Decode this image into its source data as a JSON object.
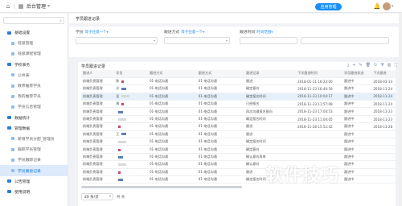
{
  "header": {
    "app_title": "后台管理",
    "app_button": "应用管理"
  },
  "sidebar": {
    "search_placeholder": "",
    "items": [
      {
        "label": "基础设置",
        "level": 1
      },
      {
        "label": "班级管理",
        "level": 2
      },
      {
        "label": "班级课程管理",
        "level": 2
      },
      {
        "label": "学校事务",
        "level": 1
      },
      {
        "label": "公共表",
        "level": 2
      },
      {
        "label": "教师推荐学员",
        "level": 2
      },
      {
        "label": "我的推荐学员",
        "level": 2
      },
      {
        "label": "学员信息管理",
        "level": 2
      },
      {
        "label": "数据统计",
        "level": 1
      },
      {
        "label": "管理数据",
        "level": 1
      },
      {
        "label": "新增学员分配_管理员",
        "level": 2
      },
      {
        "label": "跟踪学员管理",
        "level": 2
      },
      {
        "label": "学员跟踪记录",
        "level": 2
      },
      {
        "label": "学员跟进记录",
        "level": 2
      },
      {
        "label": "公告管理",
        "level": 1
      },
      {
        "label": "使用说明",
        "level": 1
      }
    ]
  },
  "page": {
    "title": "学员跟进记录",
    "filters": [
      {
        "label": "学员",
        "select": "等于任意一个"
      },
      {
        "label": "跟进方式",
        "select": "等于任意一个"
      },
      {
        "label": "跟进时间",
        "select": "时间范围"
      }
    ]
  },
  "table": {
    "title": "学员跟进记录",
    "columns": [
      "跟进人",
      "学员",
      "跟进方式",
      "跟进方式",
      "跟进记录",
      "下次跟进时间",
      "学员跟进状态",
      "下次跟进"
    ],
    "rows": [
      [
        "前端负责管理",
        "陈",
        "01-电话沟通",
        "01-电话沟通",
        "跟进",
        "2018-01-11 16:22:00",
        "跟进中",
        "2018-03-14"
      ],
      [
        "前端负责管理",
        "光",
        "01-电话沟通",
        "01-电话沟通",
        "确定意向",
        "2018-11-23 16:40:59",
        "跟进中",
        "2018-11-24"
      ],
      [
        "前端负责管理",
        "吴",
        "01-电话沟通",
        "01-电话沟通",
        "确定报名时间",
        "2018-11-23 10:04:17",
        "跟进中",
        "2018-11-24"
      ],
      [
        "前端负责管理",
        "谢",
        "01-电话沟通",
        "01-电话沟通",
        "已经报名",
        "2018-11-23 11:57:08",
        "跟进中",
        "2018-11-24"
      ],
      [
        "前端负责管理",
        "",
        "01-电话沟通",
        "01-电话沟通",
        "再次沟通报名意向",
        "2018-11-23 17:04:53",
        "跟进中",
        "2018-11-23"
      ],
      [
        "前端负责管理",
        "",
        "01-电话沟通",
        "01-电话沟通",
        "确定报名时间",
        "2018-11-23 11:04:05",
        "跟进中",
        "2018-11-23"
      ],
      [
        "前端负责管理",
        "",
        "01-电话沟通",
        "01-电话沟通",
        "跟进",
        "2018-11-28 15:52:42",
        "跟进中",
        "2018-11-28"
      ],
      [
        "前端负责管理",
        "王",
        "01-电话沟通",
        "01-电话沟通",
        "跟进",
        "",
        "跟进中",
        ""
      ],
      [
        "前端负责管理",
        "",
        "01-电话沟通",
        "01-电话沟通",
        "确定报名时间",
        "",
        "跟进中",
        ""
      ],
      [
        "前端负责管理",
        "",
        "01-电话沟通",
        "01-电话沟通",
        "确定意向",
        "",
        "跟进中",
        ""
      ],
      [
        "前端负责管理",
        "",
        "01-电话沟通",
        "01-电话沟通",
        "确认意向再来",
        "",
        "跟进中",
        ""
      ],
      [
        "前端负责管理",
        "",
        "01-电话沟通",
        "01-电话沟通",
        "确认意向",
        "",
        "跟进中",
        ""
      ],
      [
        "前端负责管理",
        "",
        "01-电话沟通",
        "01-电话沟通",
        "跟进",
        "",
        "跟进中",
        ""
      ],
      [
        "前端负责管理",
        "",
        "01-电话沟通",
        "01-电话沟通",
        "确定报名时间",
        "",
        "跟进中",
        ""
      ]
    ],
    "page_size": "20 条/页",
    "total": "共 条"
  },
  "watermark": "软件技巧",
  "colors": {
    "accent": "#1a8ef5",
    "highlight": "#e5f0fb"
  }
}
